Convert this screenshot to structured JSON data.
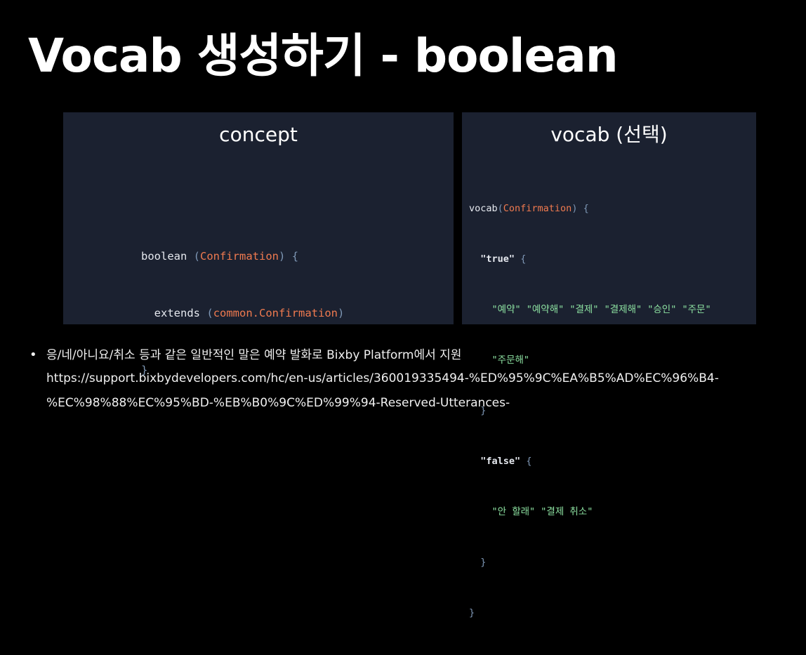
{
  "title": "Vocab 생성하기 - boolean",
  "concept_panel": {
    "heading": "concept",
    "code": {
      "line1": {
        "kw": "boolean",
        "type": "Confirmation"
      },
      "line2": {
        "kw": "extends",
        "type": "common.Confirmation"
      },
      "line3": {
        "close": "}"
      }
    }
  },
  "vocab_panel": {
    "heading": "vocab (선택)",
    "code": {
      "decl_kw": "vocab",
      "decl_type": "Confirmation",
      "true_key": "\"true\"",
      "true_values_row1": "\"예약\" \"예약해\" \"결제\" \"결제해\" \"승인\" \"주문\"",
      "true_values_row2": "\"주문해\"",
      "false_key": "\"false\"",
      "false_values": "\"안 할래\" \"결제 취소\""
    }
  },
  "bullet": {
    "text": "응/네/아니요/취소 등과 같은 일반적인 말은 예약 발화로 Bixby Platform에서 지원",
    "url_line1": "https://support.bixbydevelopers.com/hc/en-us/articles/360019335494-%ED%95%9C%EA%B5%AD%EC%96%B4-",
    "url_line2": "%EC%98%88%EC%95%BD-%EB%B0%9C%ED%99%94-Reserved-Utterances-"
  },
  "colors": {
    "background": "#000000",
    "panel": "#1b2130",
    "type_accent": "#f07a4f",
    "string_green": "#8ce0a0",
    "punctuation": "#7e97b5"
  }
}
